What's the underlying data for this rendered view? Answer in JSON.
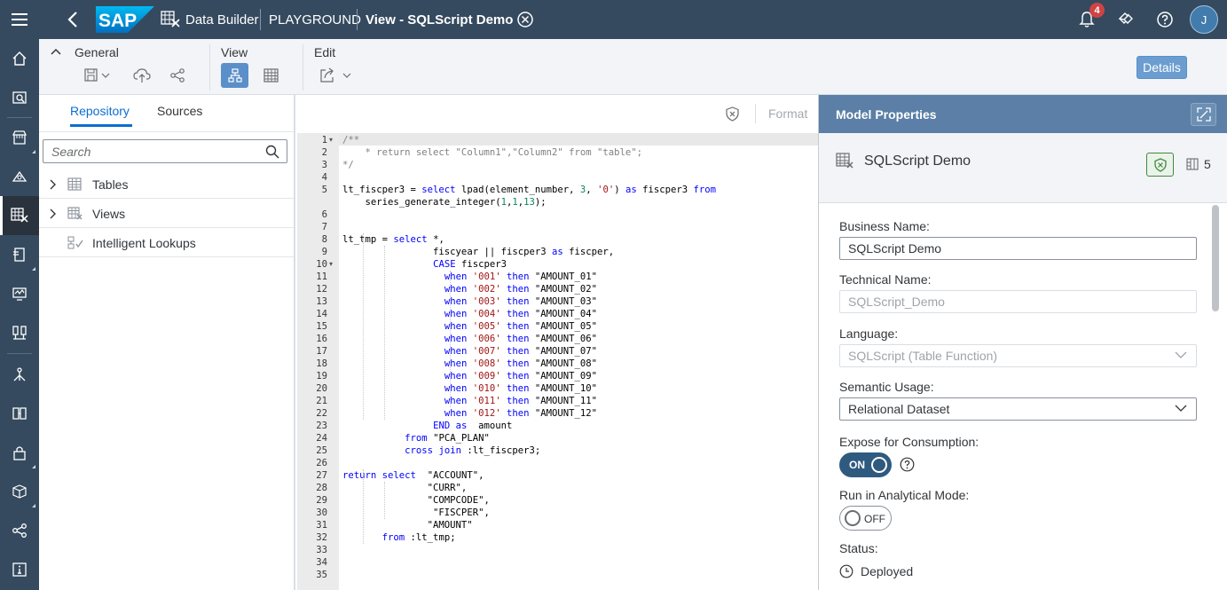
{
  "shell": {
    "logo_text": "SAP",
    "app_title": "Data Builder",
    "space": "PLAYGROUND",
    "object_title": "View - SQLScript Demo",
    "notification_count": "4",
    "avatar_initial": "J"
  },
  "toolbar": {
    "general_label": "General",
    "view_label": "View",
    "edit_label": "Edit",
    "details_label": "Details"
  },
  "left_panel": {
    "tabs": [
      "Repository",
      "Sources"
    ],
    "active_tab": "Repository",
    "search_placeholder": "Search",
    "tree": [
      {
        "label": "Tables",
        "expandable": true
      },
      {
        "label": "Views",
        "expandable": true
      },
      {
        "label": "Intelligent Lookups",
        "expandable": false
      }
    ]
  },
  "editor": {
    "format_label": "Format",
    "line_numbers": [
      "1",
      "2",
      "3",
      "4",
      "5",
      "",
      "6",
      "7",
      "8",
      "9",
      "10",
      "11",
      "12",
      "13",
      "14",
      "15",
      "16",
      "17",
      "18",
      "19",
      "20",
      "21",
      "22",
      "23",
      "24",
      "25",
      "26",
      "27",
      "28",
      "29",
      "30",
      "31",
      "32",
      "33",
      "34",
      "35"
    ],
    "lines": [
      "/**",
      "    * return select \"Column1\",\"Column2\" from \"table\";",
      "*/",
      "",
      "lt_fiscper3 = select lpad(element_number, 3, '0') as fiscper3 from",
      "    series_generate_integer(1,1,13);",
      "",
      "",
      "lt_tmp = select *,",
      "                fiscyear || fiscper3 as fiscper,",
      "                CASE fiscper3",
      "                  when '001' then \"AMOUNT_01\"",
      "                  when '002' then \"AMOUNT_02\"",
      "                  when '003' then \"AMOUNT_03\"",
      "                  when '004' then \"AMOUNT_04\"",
      "                  when '005' then \"AMOUNT_05\"",
      "                  when '006' then \"AMOUNT_06\"",
      "                  when '007' then \"AMOUNT_07\"",
      "                  when '008' then \"AMOUNT_08\"",
      "                  when '009' then \"AMOUNT_09\"",
      "                  when '010' then \"AMOUNT_10\"",
      "                  when '011' then \"AMOUNT_11\"",
      "                  when '012' then \"AMOUNT_12\"",
      "                END as  amount",
      "           from \"PCA_PLAN\"",
      "           cross join :lt_fiscper3;",
      "",
      "return select  \"ACCOUNT\",",
      "               \"CURR\",",
      "               \"COMPCODE\",",
      "                \"FISCPER\",",
      "               \"AMOUNT\"",
      "       from :lt_tmp;",
      "",
      "",
      ""
    ]
  },
  "properties": {
    "header": "Model Properties",
    "object_name": "SQLScript Demo",
    "column_count": "5",
    "business_name_label": "Business Name:",
    "business_name": "SQLScript Demo",
    "technical_name_label": "Technical Name:",
    "technical_name": "SQLScript_Demo",
    "language_label": "Language:",
    "language": "SQLScript (Table Function)",
    "semantic_usage_label": "Semantic Usage:",
    "semantic_usage": "Relational Dataset",
    "expose_label": "Expose for Consumption:",
    "expose_state": "ON",
    "analytical_label": "Run in Analytical Mode:",
    "analytical_state": "OFF",
    "status_label": "Status:",
    "status": "Deployed"
  },
  "colors": {
    "shell_bg": "#354a5f",
    "accent": "#0a6ed1",
    "panel_header": "#5b7fa6",
    "keyword": "#0000ff",
    "string": "#a31515",
    "number": "#098658",
    "comment": "#808080"
  }
}
